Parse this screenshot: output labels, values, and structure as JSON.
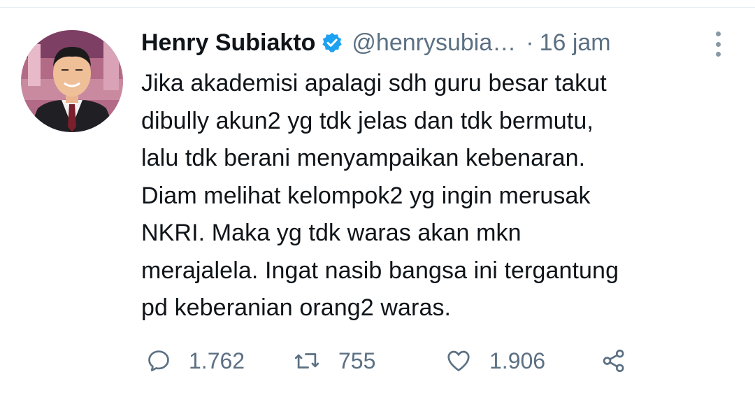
{
  "author": {
    "display_name": "Henry Subiakto",
    "handle": "@henrysubia…",
    "verified": true
  },
  "meta": {
    "separator": "·",
    "time": "16 jam"
  },
  "tweet": {
    "lines": [
      "Jika akademisi apalagi sdh guru besar takut",
      "dibully akun2 yg tdk jelas dan tdk bermutu,",
      "lalu tdk berani menyampaikan kebenaran.",
      "Diam melihat kelompok2 yg ingin merusak",
      "NKRI. Maka yg tdk waras akan mkn",
      "merajalela. Ingat nasib bangsa ini tergantung",
      "pd keberanian orang2 waras."
    ]
  },
  "actions": {
    "reply": {
      "icon": "reply-icon",
      "count": "1.762"
    },
    "retweet": {
      "icon": "retweet-icon",
      "count": "755"
    },
    "like": {
      "icon": "heart-icon",
      "count": "1.906"
    },
    "share": {
      "icon": "share-icon"
    }
  },
  "colors": {
    "text": "#0f1419",
    "secondary": "#5b7083",
    "verified": "#1da1f2",
    "divider": "#e6ecf0"
  }
}
